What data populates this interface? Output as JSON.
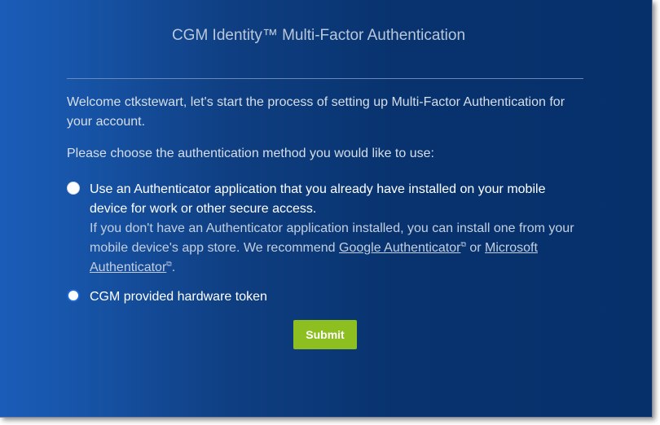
{
  "header": {
    "title": "CGM Identity™ Multi-Factor Authentication"
  },
  "intro": {
    "welcome": "Welcome ctkstewart, let's start the process of setting up Multi-Factor Authentication for your account.",
    "choose": "Please choose the authentication method you would like to use:"
  },
  "options": {
    "authenticator": {
      "label_line1": "Use an Authenticator application that you already have installed on your mobile",
      "label_line2": "device for work or other secure access.",
      "help_prefix": "If you don't have an Authenticator application installed, you can install one from your mobile device's app store. We recommend ",
      "link_google": "Google Authenticator",
      "help_or": " or ",
      "link_microsoft": "Microsoft Authenticator",
      "help_suffix": ".",
      "external_link_icon": "external-link-icon"
    },
    "hardware_token": {
      "label": "CGM provided hardware token"
    }
  },
  "actions": {
    "submit_label": "Submit"
  },
  "colors": {
    "background_left": "#1a5cb8",
    "background_right": "#06306a",
    "submit": "#8cbf1f",
    "radio_focus": "#1f66d6"
  }
}
